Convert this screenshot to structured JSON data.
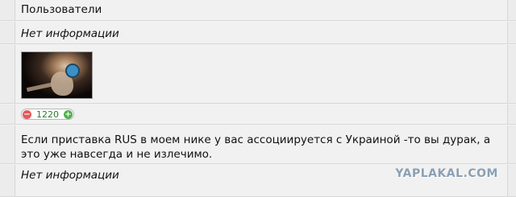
{
  "profile": {
    "group": "Пользователи",
    "info_top": "Нет информации",
    "reputation": {
      "minus_icon": "minus-icon",
      "value": "1220",
      "plus_icon": "plus-icon"
    },
    "signature": "Если приставка RUS в моем нике у вас ассоциируется с Украиной -то вы дурак, а это уже навсегда и не излечимо.",
    "info_bottom": "Нет информации"
  },
  "watermark": "YAPLAKAL.COM"
}
